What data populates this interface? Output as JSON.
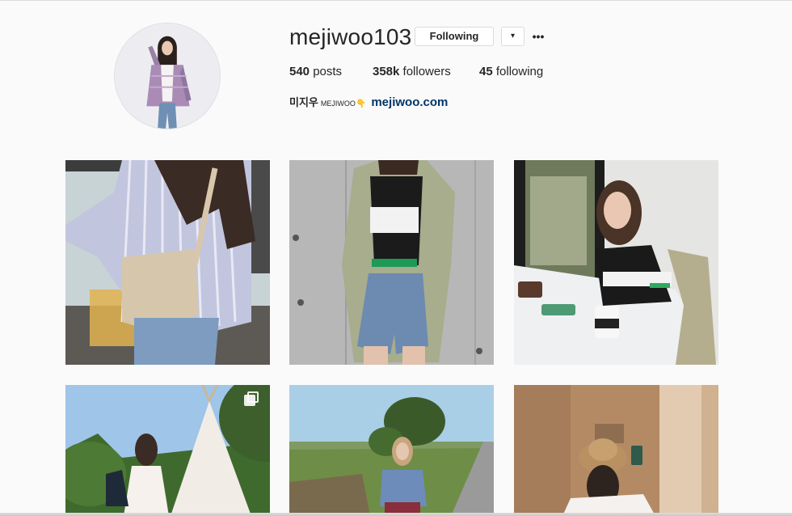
{
  "profile": {
    "username": "mejiwoo103",
    "following_button": "Following",
    "dropdown_icon": "▾",
    "more_icon": "•••",
    "stats": {
      "posts_count": "540",
      "posts_label": " posts",
      "followers_count": "358k",
      "followers_label": " followers",
      "following_count": "45",
      "following_label": " following"
    },
    "bio": {
      "name": "미지우",
      "tag": "MEJIWOO",
      "hand_icon": "👇",
      "link": "mejiwoo.com"
    }
  },
  "posts": [
    {
      "id": 1,
      "kind": "photo"
    },
    {
      "id": 2,
      "kind": "photo"
    },
    {
      "id": 3,
      "kind": "photo"
    },
    {
      "id": 4,
      "kind": "carousel"
    },
    {
      "id": 5,
      "kind": "photo"
    },
    {
      "id": 6,
      "kind": "photo"
    }
  ],
  "colors": {
    "background": "#fafafa",
    "text": "#262626",
    "link": "#003569",
    "border": "#dbdbdb"
  }
}
